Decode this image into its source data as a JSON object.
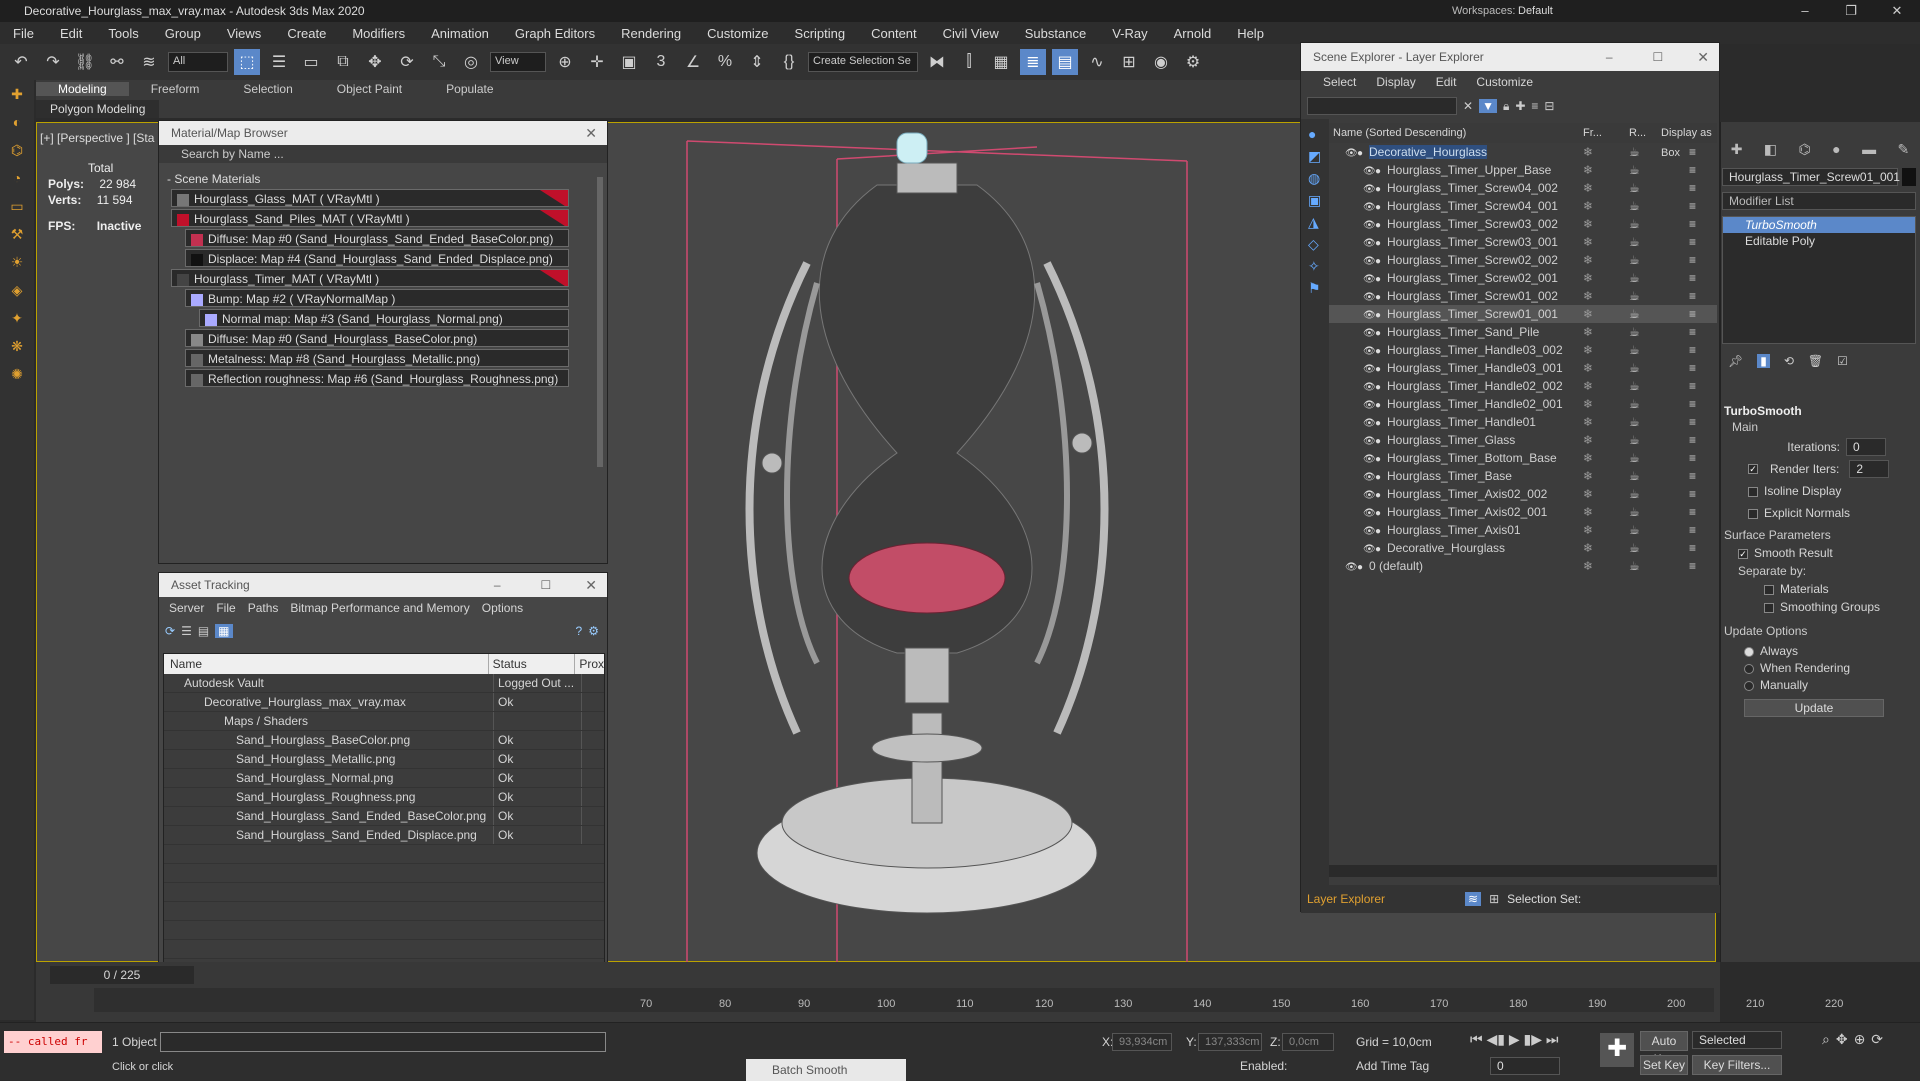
{
  "window": {
    "title": "Decorative_Hourglass_max_vray.max - Autodesk 3ds Max 2020",
    "workspace_label": "Workspaces:",
    "workspace_value": "Default"
  },
  "menu": [
    "File",
    "Edit",
    "Tools",
    "Group",
    "Views",
    "Create",
    "Modifiers",
    "Animation",
    "Graph Editors",
    "Rendering",
    "Customize",
    "Scripting",
    "Content",
    "Civil View",
    "Substance",
    "V-Ray",
    "Arnold",
    "Help"
  ],
  "toolbar": {
    "filter": "All",
    "view": "View",
    "selection_set": "Create Selection Se"
  },
  "ribbon": {
    "tabs": [
      "Modeling",
      "Freeform",
      "Selection",
      "Object Paint",
      "Populate"
    ],
    "sub": "Polygon Modeling"
  },
  "viewport": {
    "label": "[+] [Perspective ] [Sta",
    "stats_total": "Total",
    "polys_label": "Polys:",
    "polys": "22 984",
    "verts_label": "Verts:",
    "verts": "11 594",
    "fps_label": "FPS:",
    "fps": "Inactive"
  },
  "material_browser": {
    "title": "Material/Map Browser",
    "search": "Search by Name ...",
    "group": "- Scene Materials",
    "items": [
      "Hourglass_Glass_MAT ( VRayMtl )",
      "Hourglass_Sand_Piles_MAT ( VRayMtl )",
      "Diffuse: Map #0 (Sand_Hourglass_Sand_Ended_BaseColor.png)",
      "Displace: Map #4 (Sand_Hourglass_Sand_Ended_Displace.png)",
      "Hourglass_Timer_MAT ( VRayMtl )",
      "Bump: Map #2 ( VRayNormalMap )",
      "Normal map: Map #3 (Sand_Hourglass_Normal.png)",
      "Diffuse: Map #0 (Sand_Hourglass_BaseColor.png)",
      "Metalness: Map #8 (Sand_Hourglass_Metallic.png)",
      "Reflection roughness: Map #6 (Sand_Hourglass_Roughness.png)"
    ]
  },
  "asset_tracking": {
    "title": "Asset Tracking",
    "menu": [
      "Server",
      "File",
      "Paths",
      "Bitmap Performance and Memory",
      "Options"
    ],
    "columns": [
      "Name",
      "Status",
      "Prox"
    ],
    "rows": [
      {
        "name": "Autodesk Vault",
        "status": "Logged Out ..."
      },
      {
        "name": "Decorative_Hourglass_max_vray.max",
        "status": "Ok"
      },
      {
        "name": "Maps / Shaders",
        "status": ""
      },
      {
        "name": "Sand_Hourglass_BaseColor.png",
        "status": "Ok"
      },
      {
        "name": "Sand_Hourglass_Metallic.png",
        "status": "Ok"
      },
      {
        "name": "Sand_Hourglass_Normal.png",
        "status": "Ok"
      },
      {
        "name": "Sand_Hourglass_Roughness.png",
        "status": "Ok"
      },
      {
        "name": "Sand_Hourglass_Sand_Ended_BaseColor.png",
        "status": "Ok"
      },
      {
        "name": "Sand_Hourglass_Sand_Ended_Displace.png",
        "status": "Ok"
      }
    ]
  },
  "scene_explorer": {
    "title": "Scene Explorer - Layer Explorer",
    "menu": [
      "Select",
      "Display",
      "Edit",
      "Customize"
    ],
    "col_name": "Name (Sorted Descending)",
    "col_fr": "Fr...",
    "col_r": "R...",
    "col_box": "Display as Box",
    "root": "Decorative_Hourglass",
    "items": [
      "Hourglass_Timer_Upper_Base",
      "Hourglass_Timer_Screw04_002",
      "Hourglass_Timer_Screw04_001",
      "Hourglass_Timer_Screw03_002",
      "Hourglass_Timer_Screw03_001",
      "Hourglass_Timer_Screw02_002",
      "Hourglass_Timer_Screw02_001",
      "Hourglass_Timer_Screw01_002",
      "Hourglass_Timer_Screw01_001",
      "Hourglass_Timer_Sand_Pile",
      "Hourglass_Timer_Handle03_002",
      "Hourglass_Timer_Handle03_001",
      "Hourglass_Timer_Handle02_002",
      "Hourglass_Timer_Handle02_001",
      "Hourglass_Timer_Handle01",
      "Hourglass_Timer_Glass",
      "Hourglass_Timer_Bottom_Base",
      "Hourglass_Timer_Base",
      "Hourglass_Timer_Axis02_002",
      "Hourglass_Timer_Axis02_001",
      "Hourglass_Timer_Axis01",
      "Decorative_Hourglass"
    ],
    "default_layer": "0 (default)",
    "footer_dropdown": "Layer Explorer",
    "footer_selset": "Selection Set:"
  },
  "modify": {
    "object_name": "Hourglass_Timer_Screw01_001",
    "modifier_list": "Modifier List",
    "stack": [
      "TurboSmooth",
      "Editable Poly"
    ],
    "rollout": "TurboSmooth",
    "main": "Main",
    "iterations_label": "Iterations:",
    "iterations": "0",
    "render_iters_label": "Render Iters:",
    "render_iters": "2",
    "isoline": "Isoline Display",
    "explicit": "Explicit Normals",
    "surface": "Surface Parameters",
    "smooth_result": "Smooth Result",
    "separate": "Separate by:",
    "materials": "Materials",
    "smoothing": "Smoothing Groups",
    "update_opts": "Update Options",
    "always": "Always",
    "when_rendering": "When Rendering",
    "manually": "Manually",
    "update_btn": "Update"
  },
  "timeline": {
    "frame": "0 / 225",
    "ticks": [
      "70",
      "80",
      "90",
      "100",
      "110",
      "120",
      "130",
      "140",
      "150",
      "160",
      "170",
      "180",
      "190",
      "200",
      "210",
      "220"
    ]
  },
  "status": {
    "objects": "1 Object",
    "hint": "Click or click",
    "script": "-- called fr",
    "x_label": "X:",
    "x": "93,934cm",
    "y_label": "Y:",
    "y": "137,333cm",
    "z_label": "Z:",
    "z": "0,0cm",
    "grid": "Grid = 10,0cm",
    "enabled": "Enabled:",
    "add_time_tag": "Add Time Tag",
    "auto_key": "Auto Key",
    "set_key": "Set Key",
    "selected": "Selected",
    "key_filters": "Key Filters...",
    "frame_field": "0",
    "batch_smooth": "Batch Smooth"
  }
}
